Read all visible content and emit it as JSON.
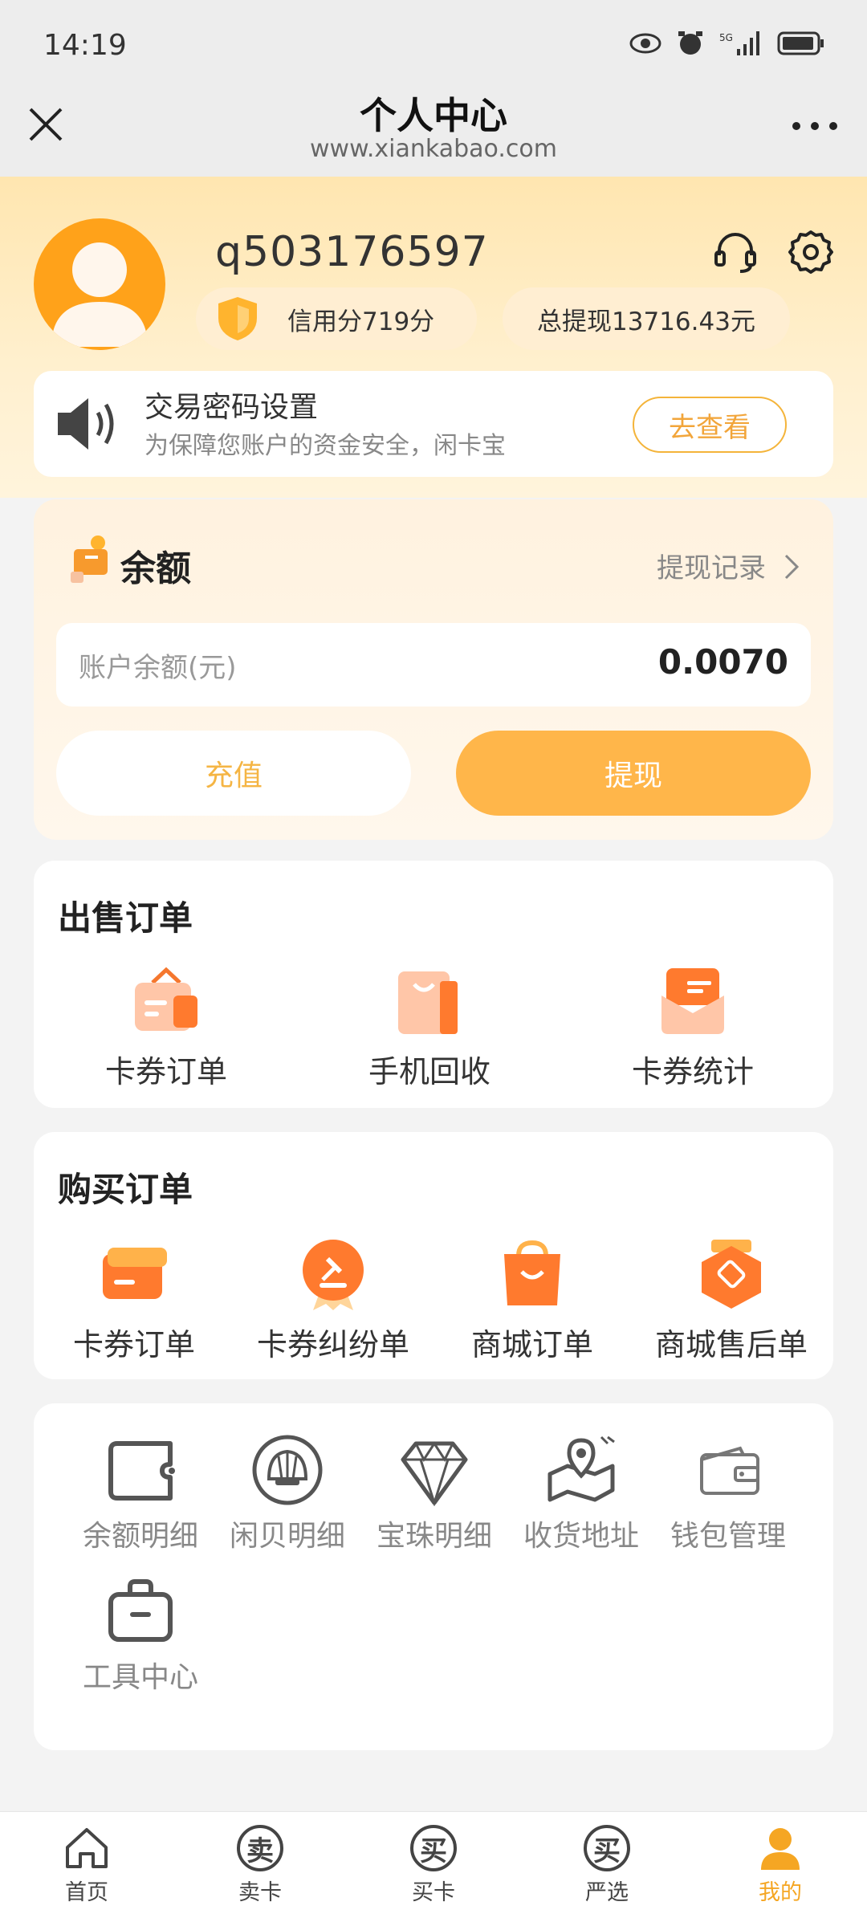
{
  "status_bar": {
    "time": "14:19"
  },
  "header": {
    "title": "个人中心",
    "subtitle": "www.xiankabao.com"
  },
  "profile": {
    "username": "q503176597",
    "credit": "信用分719分",
    "total_withdraw": "总提现13716.43元"
  },
  "notice": {
    "title": "交易密码设置",
    "description": "为保障您账户的资金安全，闲卡宝",
    "button": "去查看"
  },
  "balance": {
    "title": "余额",
    "record_link": "提现记录",
    "label": "账户余额(元)",
    "value": "0.0070",
    "recharge": "充值",
    "withdraw": "提现"
  },
  "sell_orders": {
    "title": "出售订单",
    "items": [
      {
        "label": "卡券订单",
        "icon": "card-order-icon"
      },
      {
        "label": "手机回收",
        "icon": "phone-recycle-icon"
      },
      {
        "label": "卡券统计",
        "icon": "card-stats-icon"
      }
    ]
  },
  "buy_orders": {
    "title": "购买订单",
    "items": [
      {
        "label": "卡券订单",
        "icon": "card-order-icon"
      },
      {
        "label": "卡券纠纷单",
        "icon": "dispute-icon"
      },
      {
        "label": "商城订单",
        "icon": "mall-order-icon"
      },
      {
        "label": "商城售后单",
        "icon": "after-sale-icon"
      }
    ]
  },
  "tools": {
    "items": [
      {
        "label": "余额明细",
        "icon": "wallet-card-icon"
      },
      {
        "label": "闲贝明细",
        "icon": "shell-icon"
      },
      {
        "label": "宝珠明细",
        "icon": "diamond-icon"
      },
      {
        "label": "收货地址",
        "icon": "location-icon"
      },
      {
        "label": "钱包管理",
        "icon": "wallet-icon"
      },
      {
        "label": "工具中心",
        "icon": "toolbox-icon"
      }
    ]
  },
  "tabbar": {
    "items": [
      {
        "label": "首页",
        "glyph": ""
      },
      {
        "label": "卖卡",
        "glyph": "卖"
      },
      {
        "label": "买卡",
        "glyph": "买"
      },
      {
        "label": "严选",
        "glyph": "买"
      },
      {
        "label": "我的",
        "glyph": ""
      }
    ],
    "active_color": "#f5a623"
  },
  "colors": {
    "accent": "#ffb64a",
    "accent_text": "#f2a53a"
  }
}
